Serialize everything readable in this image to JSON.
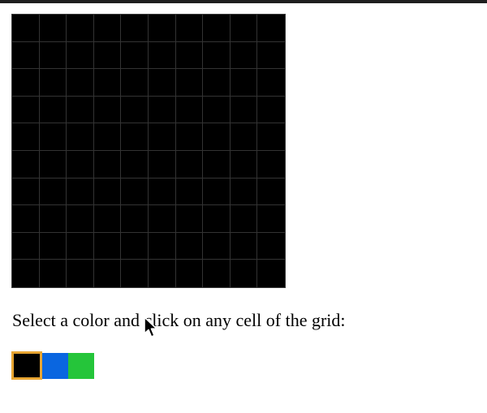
{
  "instruction": "Select a color and click on any cell of the grid:",
  "grid": {
    "rows": 10,
    "cols": 10,
    "cell_color": "#000000",
    "line_color": "#333333"
  },
  "palette": {
    "colors": [
      {
        "name": "black",
        "hex": "#000000",
        "selected": true
      },
      {
        "name": "blue",
        "hex": "#0a66e0",
        "selected": false
      },
      {
        "name": "green",
        "hex": "#25c53a",
        "selected": false
      }
    ],
    "selected_border": "#e8a532"
  },
  "icons": {
    "cursor": "mouse-pointer-icon"
  }
}
